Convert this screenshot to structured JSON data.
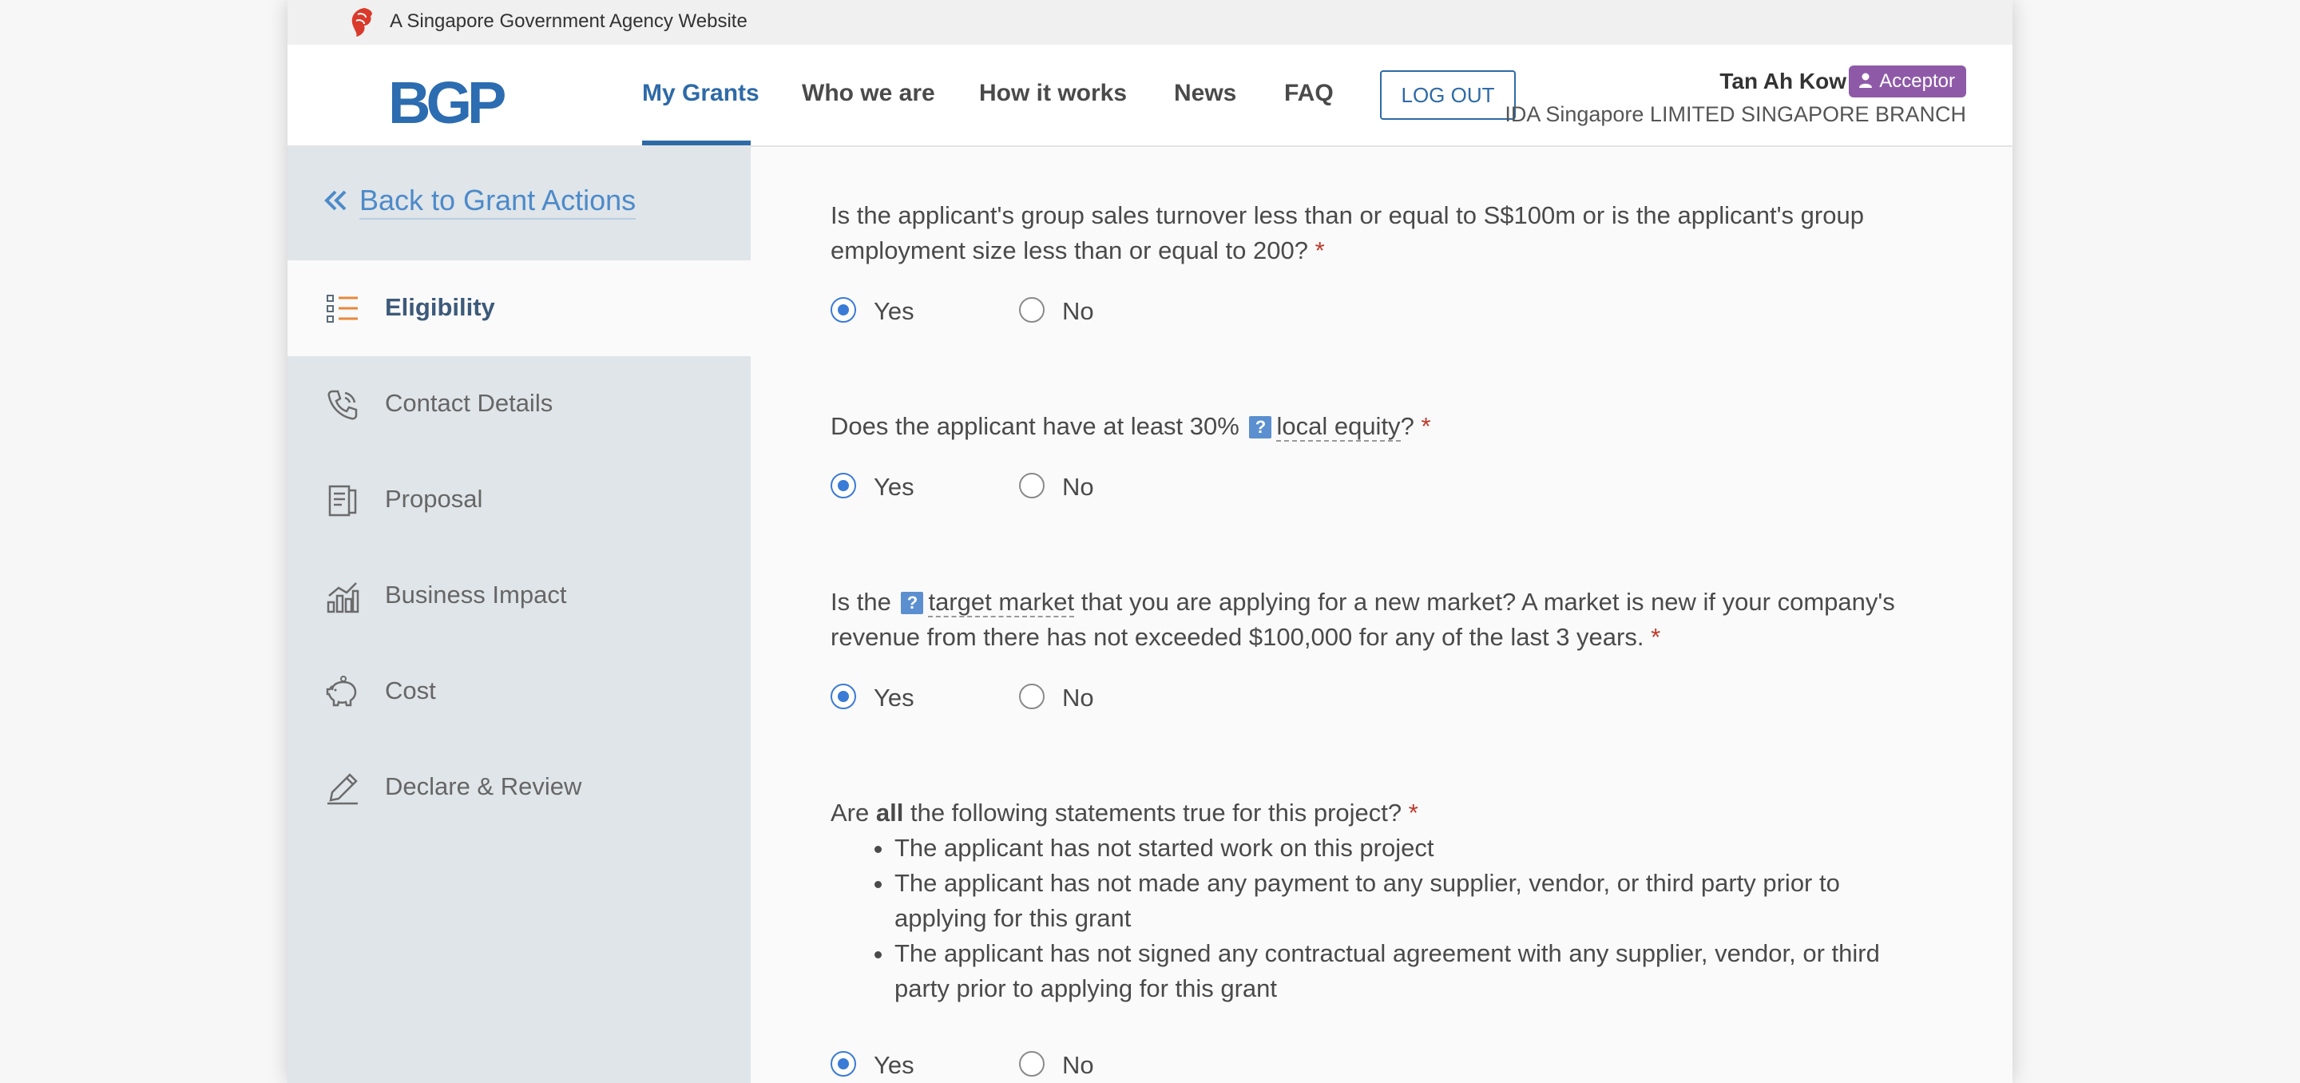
{
  "masthead": {
    "text": "A Singapore Government Agency Website"
  },
  "header": {
    "logo": "BGP",
    "nav": [
      "My Grants",
      "Who we are",
      "How it works",
      "News",
      "FAQ"
    ],
    "logout_label": "LOG OUT",
    "user_name": "Tan Ah Kow",
    "role": "Acceptor",
    "org": "IDA Singapore LIMITED SINGAPORE BRANCH"
  },
  "sidebar": {
    "back_label": "Back to Grant Actions",
    "items": [
      {
        "label": "Eligibility",
        "icon": "list-icon",
        "active": true
      },
      {
        "label": "Contact Details",
        "icon": "phone-icon"
      },
      {
        "label": "Proposal",
        "icon": "document-icon"
      },
      {
        "label": "Business Impact",
        "icon": "bar-chart-icon"
      },
      {
        "label": "Cost",
        "icon": "piggy-bank-icon"
      },
      {
        "label": "Declare & Review",
        "icon": "pen-sign-icon"
      }
    ]
  },
  "main": {
    "q1": {
      "text": "Is the applicant's group sales turnover less than or equal to S$100m or is the applicant's group employment size less than or equal to 200?",
      "required": "*"
    },
    "q2": {
      "before": "Does the applicant have at least 30%",
      "help": "?",
      "term": "local equity",
      "after": "?",
      "required": "*"
    },
    "q3": {
      "before": "Is the",
      "help": "?",
      "term": "target market",
      "after": "that you are applying for a new market? A market is new if your company's revenue from there has not exceeded $100,000 for any of the last 3 years.",
      "required": "*"
    },
    "q4": {
      "before": "Are",
      "bold": "all",
      "after": "the following statements true for this project?",
      "required": "*",
      "bullets": [
        "The applicant has not started work on this project",
        "The applicant has not made any payment to any supplier, vendor, or third party prior to applying for this grant",
        "The applicant has not signed any contractual agreement with any supplier, vendor, or third party prior to applying for this grant"
      ]
    },
    "options": {
      "yes": "Yes",
      "no": "No"
    },
    "answers": [
      "Yes",
      "Yes",
      "Yes",
      "Yes"
    ]
  },
  "colors": {
    "primary": "#2e6aa7",
    "badge": "#8e5aa8",
    "required": "#c0392b",
    "radio": "#3a7bd5"
  }
}
